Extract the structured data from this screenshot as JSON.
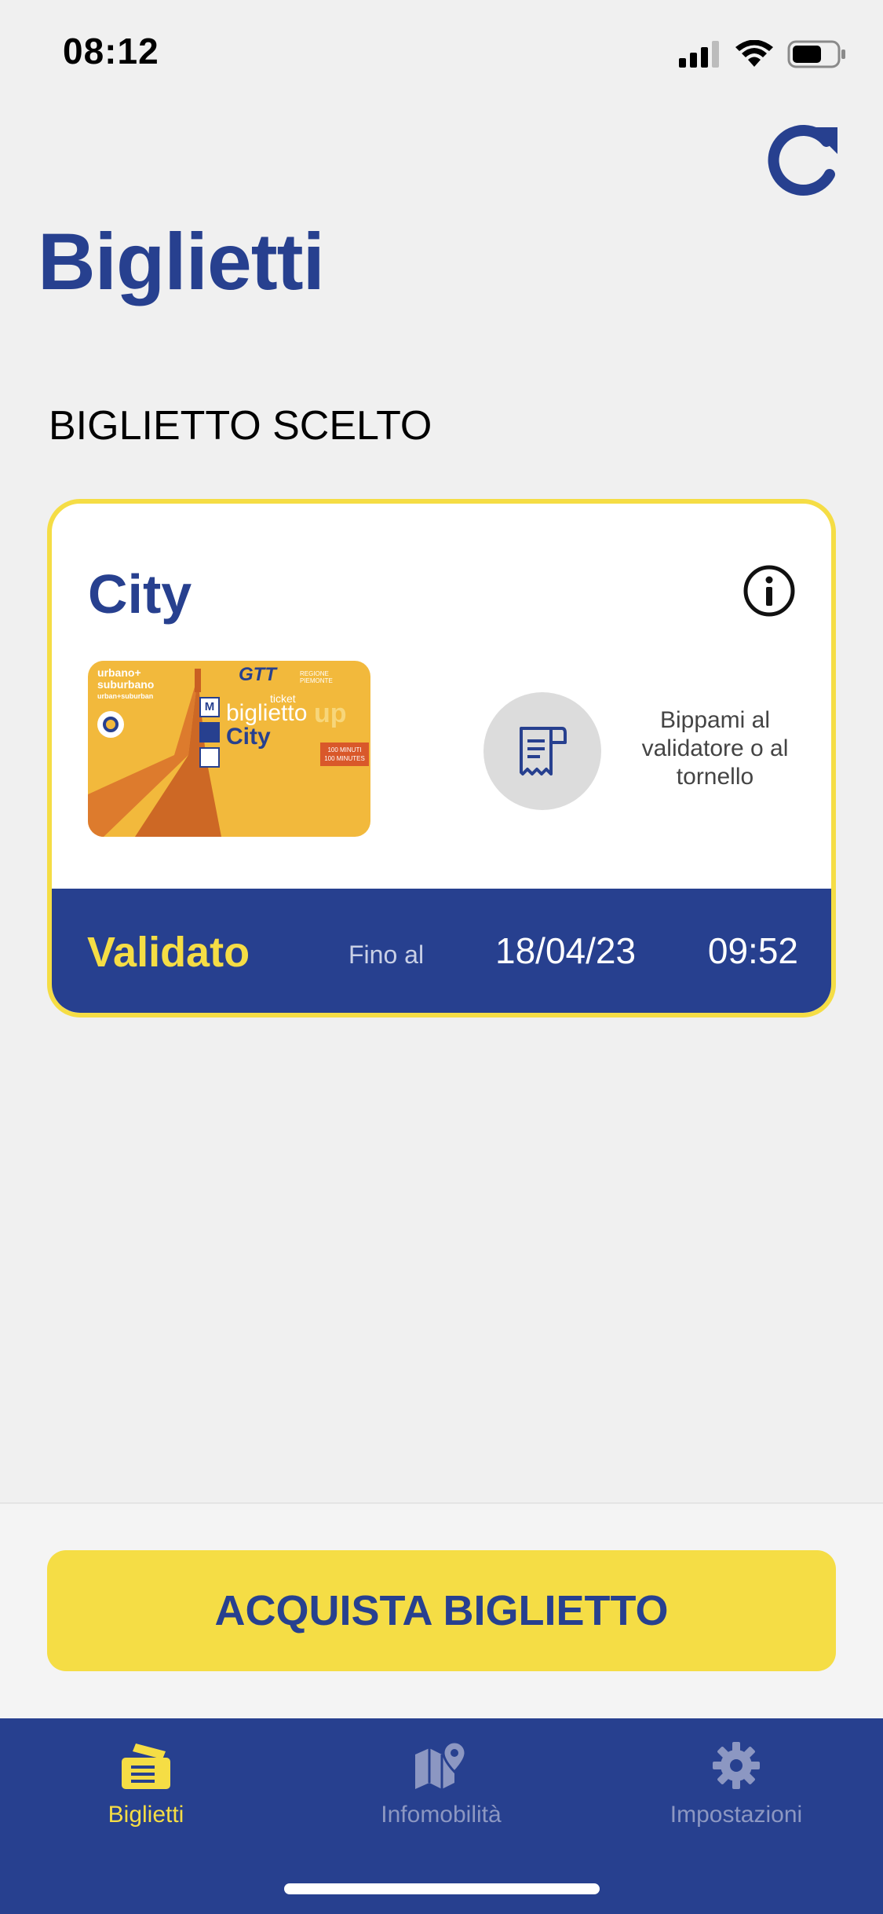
{
  "status_bar": {
    "time": "08:12"
  },
  "header": {
    "title": "Biglietti"
  },
  "section": {
    "label": "BIGLIETTO SCELTO"
  },
  "ticket": {
    "name": "City",
    "image": {
      "zone_line1": "urbano+",
      "zone_line2": "suburbano",
      "zone_sub": "urban+suburban",
      "brand": "GTT",
      "region": "REGIONE PIEMONTE",
      "small_label": "ticket",
      "label": "biglietto",
      "product": "City",
      "duration_line1": "100 MINUTI",
      "duration_line2": "100 MINUTES"
    },
    "validator_hint": "Bippami al validatore o al tornello",
    "status": "Validato",
    "valid_until_label": "Fino al",
    "valid_until_date": "18/04/23",
    "valid_until_time": "09:52"
  },
  "actions": {
    "buy_label": "ACQUISTA BIGLIETTO"
  },
  "tabbar": {
    "tabs": [
      {
        "label": "Biglietti",
        "icon": "ticket-icon",
        "active": true
      },
      {
        "label": "Infomobilità",
        "icon": "map-pin-icon",
        "active": false
      },
      {
        "label": "Impostazioni",
        "icon": "gear-icon",
        "active": false
      }
    ]
  },
  "colors": {
    "brand_blue": "#27408f",
    "accent_yellow": "#f5dd45",
    "background": "#f0f0f0"
  }
}
